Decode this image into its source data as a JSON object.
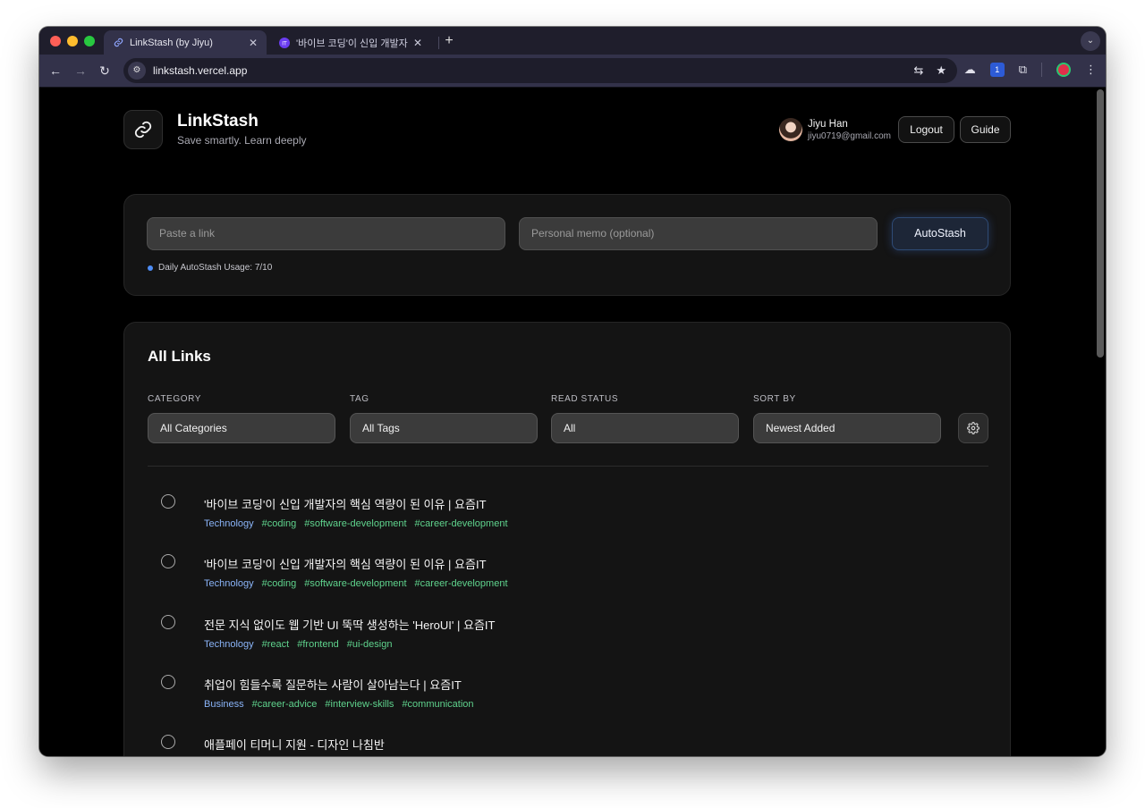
{
  "browser": {
    "tabs": [
      {
        "title": "LinkStash (by Jiyu)",
        "active": true
      },
      {
        "title": "'바이브 코딩'이 신입 개발자의 핵심",
        "active": false
      }
    ],
    "url": "linkstash.vercel.app"
  },
  "app": {
    "title": "LinkStash",
    "subtitle": "Save smartly. Learn deeply"
  },
  "user": {
    "name": "Jiyu Han",
    "email": "jiyu0719@gmail.com"
  },
  "header_buttons": {
    "logout": "Logout",
    "guide": "Guide"
  },
  "stash": {
    "link_placeholder": "Paste a link",
    "memo_placeholder": "Personal memo (optional)",
    "button": "AutoStash",
    "usage": "Daily AutoStash Usage: 7/10"
  },
  "links": {
    "title": "All Links",
    "filters": {
      "category": {
        "label": "CATEGORY",
        "value": "All Categories"
      },
      "tag": {
        "label": "TAG",
        "value": "All Tags"
      },
      "read_status": {
        "label": "READ STATUS",
        "value": "All"
      },
      "sort_by": {
        "label": "SORT BY",
        "value": "Newest Added"
      }
    },
    "items": [
      {
        "title": "'바이브 코딩'이 신입 개발자의 핵심 역량이 된 이유 | 요즘IT",
        "category": "Technology",
        "tags": [
          "#coding",
          "#software-development",
          "#career-development"
        ]
      },
      {
        "title": "'바이브 코딩'이 신입 개발자의 핵심 역량이 된 이유 | 요즘IT",
        "category": "Technology",
        "tags": [
          "#coding",
          "#software-development",
          "#career-development"
        ]
      },
      {
        "title": "전문 지식 없이도 웹 기반 UI 뚝딱 생성하는 'HeroUI' | 요즘IT",
        "category": "Technology",
        "tags": [
          "#react",
          "#frontend",
          "#ui-design"
        ]
      },
      {
        "title": "취업이 힘들수록 질문하는 사람이 살아남는다 | 요즘IT",
        "category": "Business",
        "tags": [
          "#career-advice",
          "#interview-skills",
          "#communication"
        ]
      },
      {
        "title": "애플페이 티머니 지원 - 디자인 나침반",
        "category": "",
        "tags": []
      }
    ]
  },
  "colors": {
    "accent_blue": "#8ab4f8",
    "tag_green": "#5fd38d",
    "background": "#000000"
  }
}
